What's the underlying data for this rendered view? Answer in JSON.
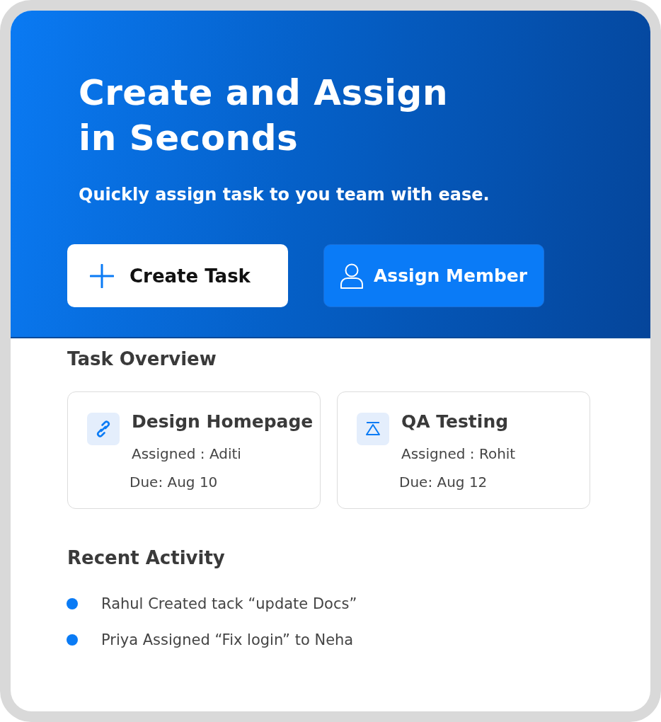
{
  "hero": {
    "title": "Create and Assign in Seconds",
    "subtitle": "Quickly assign task to you team with ease.",
    "buttons": [
      {
        "label": "Create Task",
        "kind": "light"
      },
      {
        "label": "Assign Member",
        "kind": "solid"
      }
    ]
  },
  "task_overview": {
    "heading": "Task Overview",
    "tasks": [
      {
        "kind": "design",
        "title": "Design Homepage",
        "assigned": "Assigned : Aditi",
        "due": "Due: Aug 10"
      },
      {
        "kind": "qa",
        "title": "QA Testing",
        "assigned": "Assigned : Rohit",
        "due": "Due: Aug 12"
      }
    ]
  },
  "recent_activity": {
    "heading": "Recent Activity",
    "items": [
      "Rahul Created tack “update Docs”",
      "Priya Assigned “Fix login” to Neha"
    ]
  }
}
